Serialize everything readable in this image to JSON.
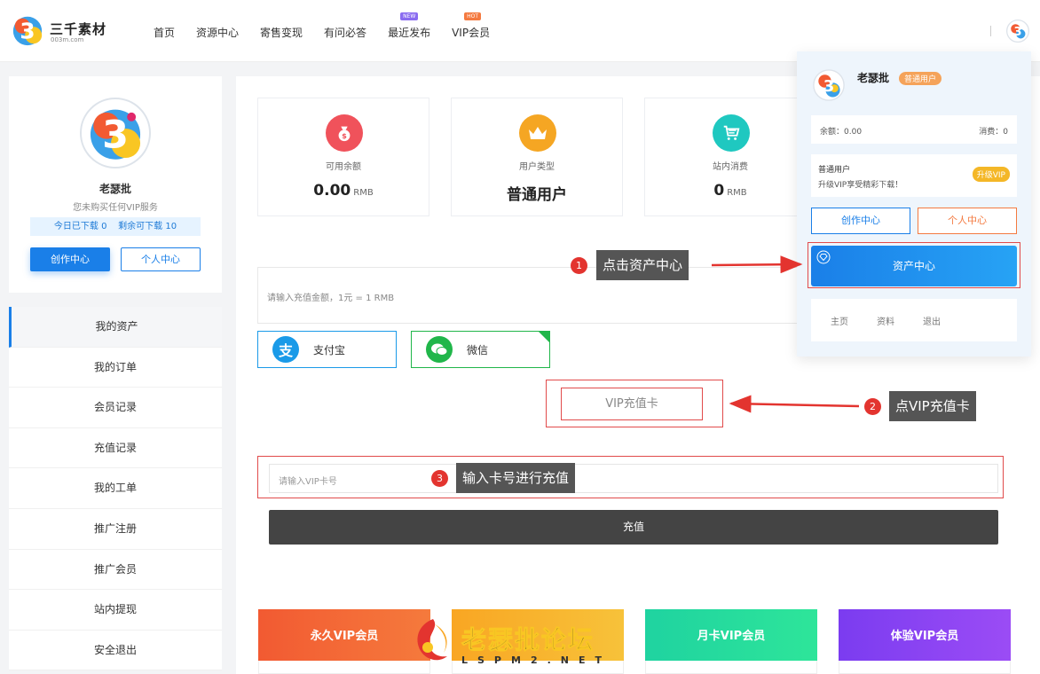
{
  "header": {
    "logo_text": "三千素材",
    "logo_sub": "003m.com",
    "nav": [
      {
        "label": "首页"
      },
      {
        "label": "资源中心"
      },
      {
        "label": "寄售变现"
      },
      {
        "label": "有问必答"
      },
      {
        "label": "最近发布",
        "badge": "NEW",
        "badge_color": "#8a6cf0"
      },
      {
        "label": "VIP会员",
        "badge": "HOT",
        "badge_color": "#f47a40"
      }
    ]
  },
  "profile": {
    "name": "老瑟批",
    "desc": "您未购买任何VIP服务",
    "download_info": "今日已下载 0    剩余可下载 10",
    "create_btn": "创作中心",
    "personal_btn": "个人中心"
  },
  "side_menu": [
    "我的资产",
    "我的订单",
    "会员记录",
    "充值记录",
    "我的工单",
    "推广注册",
    "推广会员",
    "站内提现",
    "安全退出"
  ],
  "stats": [
    {
      "label": "可用余额",
      "value": "0.00",
      "unit": "RMB",
      "icon": "money-bag-icon",
      "color": "#f0525b"
    },
    {
      "label": "用户类型",
      "value": "普通用户",
      "unit": "",
      "icon": "crown-icon",
      "color": "#f5a623"
    },
    {
      "label": "站内消费",
      "value": "0",
      "unit": "RMB",
      "icon": "cart-icon",
      "color": "#1fc8c0"
    }
  ],
  "recharge": {
    "amount_placeholder": "请输入充值金额，1元 = 1 RMB",
    "alipay_label": "支付宝",
    "wechat_label": "微信",
    "vip_card_label": "VIP充值卡",
    "vip_input_placeholder": "请输入VIP卡号",
    "submit_label": "充值"
  },
  "vip_tiles": [
    {
      "label": "永久VIP会员",
      "color": "#f25a32"
    },
    {
      "label": "",
      "color": "#f9a623"
    },
    {
      "label": "月卡VIP会员",
      "color": "#1fd3a0"
    },
    {
      "label": "体验VIP会员",
      "color": "#7b3cf0"
    }
  ],
  "callouts": {
    "c1_num": "1",
    "c1_text": "点击资产中心",
    "c2_num": "2",
    "c2_text": "点VIP充值卡",
    "c3_num": "3",
    "c3_text": "输入卡号进行充值"
  },
  "dropdown": {
    "name": "老瑟批",
    "badge": "普通用户",
    "balance_label": "余额：0.00",
    "spent_label": "消费：0",
    "user_type": "普通用户",
    "upgrade_tip": "升级VIP享受精彩下载！",
    "upgrade_tag": "升级VIP",
    "create_btn": "创作中心",
    "personal_btn": "个人中心",
    "asset_btn": "资产中心",
    "links": [
      "主页",
      "资料",
      "退出"
    ]
  },
  "watermark": {
    "text": "老瑟批论坛",
    "sub": "LSPM2.NET"
  }
}
